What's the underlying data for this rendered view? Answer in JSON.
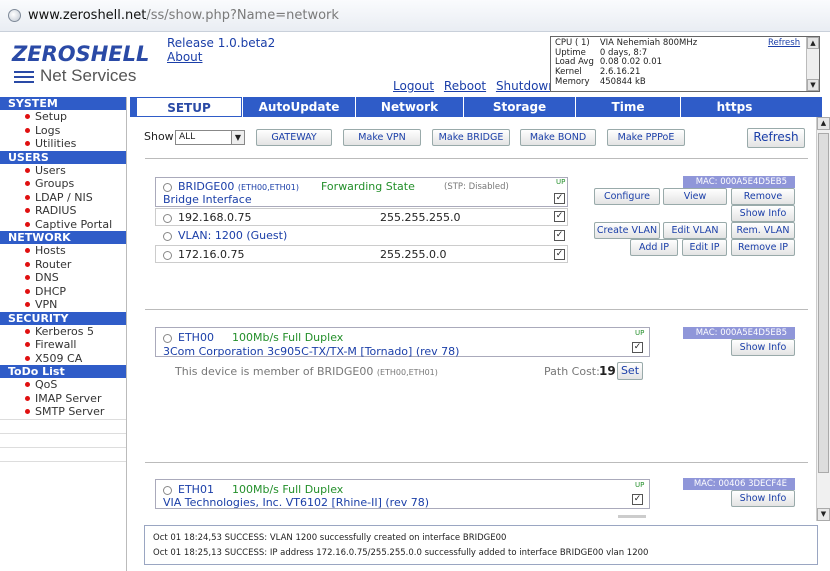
{
  "browser": {
    "url_host": "www.zeroshell.net",
    "url_path": "/ss/show.php?Name=network"
  },
  "header": {
    "logo_title": "ZEROSHELL",
    "logo_subtitle": "Net Services",
    "release": "Release 1.0.beta2",
    "about": "About",
    "links": {
      "logout": "Logout",
      "reboot": "Reboot",
      "shutdown": "Shutdown"
    }
  },
  "sysinfo": {
    "refresh": "Refresh",
    "rows": [
      {
        "label": "CPU ( 1)",
        "value": "VIA Nehemiah 800MHz"
      },
      {
        "label": "Uptime",
        "value": "0 days, 8:7"
      },
      {
        "label": "Load Avg",
        "value": "0.08 0.02 0.01"
      },
      {
        "label": "Kernel",
        "value": "2.6.16.21"
      },
      {
        "label": "Memory",
        "value": "450844 kB"
      }
    ]
  },
  "nav": {
    "tabs": [
      "SETUP",
      "AutoUpdate",
      "Network",
      "Storage",
      "Time",
      "https"
    ],
    "active": "SETUP"
  },
  "sidebar": {
    "sections": [
      {
        "title": "SYSTEM",
        "items": [
          "Setup",
          "Logs",
          "Utilities"
        ]
      },
      {
        "title": "USERS",
        "items": [
          "Users",
          "Groups",
          "LDAP / NIS",
          "RADIUS",
          "Captive Portal"
        ]
      },
      {
        "title": "NETWORK",
        "items": [
          "Hosts",
          "Router",
          "DNS",
          "DHCP",
          "VPN"
        ]
      },
      {
        "title": "SECURITY",
        "items": [
          "Kerberos 5",
          "Firewall",
          "X509 CA"
        ]
      },
      {
        "title": "ToDo List",
        "items": [
          "QoS",
          "IMAP Server",
          "SMTP Server"
        ]
      }
    ]
  },
  "toolbar": {
    "show_label": "Show",
    "show_value": "ALL",
    "buttons": [
      "GATEWAY",
      "Make VPN",
      "Make BRIDGE",
      "Make BOND",
      "Make PPPoE"
    ],
    "refresh": "Refresh"
  },
  "bridge": {
    "name": "BRIDGE00",
    "members": "(ETH00,ETH01)",
    "state": "Forwarding State",
    "stp": "(STP: Disabled)",
    "desc": "Bridge Interface",
    "up": "UP",
    "mac": "MAC: 000A5E4D5EB5",
    "ips": [
      {
        "ip": "192.168.0.75",
        "mask": "255.255.255.0"
      }
    ],
    "vlan": {
      "label": "VLAN: 1200",
      "name": "(Guest)"
    },
    "vlan_ips": [
      {
        "ip": "172.16.0.75",
        "mask": "255.255.0.0"
      }
    ],
    "buttons": {
      "configure": "Configure",
      "view": "View",
      "remove": "Remove",
      "show_info": "Show Info",
      "create_vlan": "Create VLAN",
      "edit_vlan": "Edit VLAN",
      "rem_vlan": "Rem. VLAN",
      "add_ip": "Add IP",
      "edit_ip": "Edit IP",
      "remove_ip": "Remove IP"
    }
  },
  "eth00": {
    "name": "ETH00",
    "speed": "100Mb/s Full Duplex",
    "desc": "3Com Corporation 3c905C-TX/TX-M [Tornado] (rev 78)",
    "up": "UP",
    "mac": "MAC: 000A5E4D5EB5",
    "show_info": "Show Info",
    "member_text": "This device is member of BRIDGE00",
    "member_small": "(ETH00,ETH01)",
    "path_cost_label": "Path Cost:",
    "path_cost": "19",
    "set": "Set"
  },
  "eth01": {
    "name": "ETH01",
    "speed": "100Mb/s Full Duplex",
    "desc": "VIA Technologies, Inc. VT6102 [Rhine-II] (rev 78)",
    "up": "UP",
    "mac": "MAC: 00406 3DECF4E",
    "show_info": "Show Info"
  },
  "log": [
    "Oct 01 18:24,53 SUCCESS: VLAN 1200 successfully created on interface BRIDGE00",
    "Oct 01 18:25,13 SUCCESS: IP address 172.16.0.75/255.255.0.0 successfully added to interface BRIDGE00 vlan 1200"
  ]
}
